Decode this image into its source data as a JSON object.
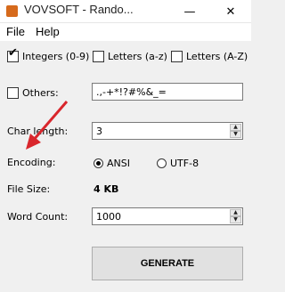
{
  "window": {
    "title": "VOVSOFT - Rando...",
    "minimize_glyph": "—",
    "close_glyph": "✕"
  },
  "menu": [
    "File",
    "Help"
  ],
  "options": {
    "integers": {
      "label": "Integers (0-9)",
      "checked": true
    },
    "letters_lower": {
      "label": "Letters (a-z)",
      "checked": false
    },
    "letters_upper": {
      "label": "Letters (A-Z)",
      "checked": false
    },
    "others": {
      "label": "Others:",
      "checked": false,
      "value": ".,-+*!?#%&_="
    }
  },
  "char_length": {
    "label": "Char length:",
    "value": "3"
  },
  "encoding": {
    "label": "Encoding:",
    "options": [
      {
        "label": "ANSI",
        "selected": true
      },
      {
        "label": "UTF-8",
        "selected": false
      }
    ]
  },
  "file_size": {
    "label": "File Size:",
    "value": "4 KB"
  },
  "word_count": {
    "label": "Word Count:",
    "value": "1000"
  },
  "generate_label": "GENERATE",
  "colors": {
    "annotation_arrow": "#d9262c",
    "app_icon": "#d66a1c"
  },
  "icons": {
    "check": "✔",
    "spin_up": "▲",
    "spin_down": "▼"
  }
}
